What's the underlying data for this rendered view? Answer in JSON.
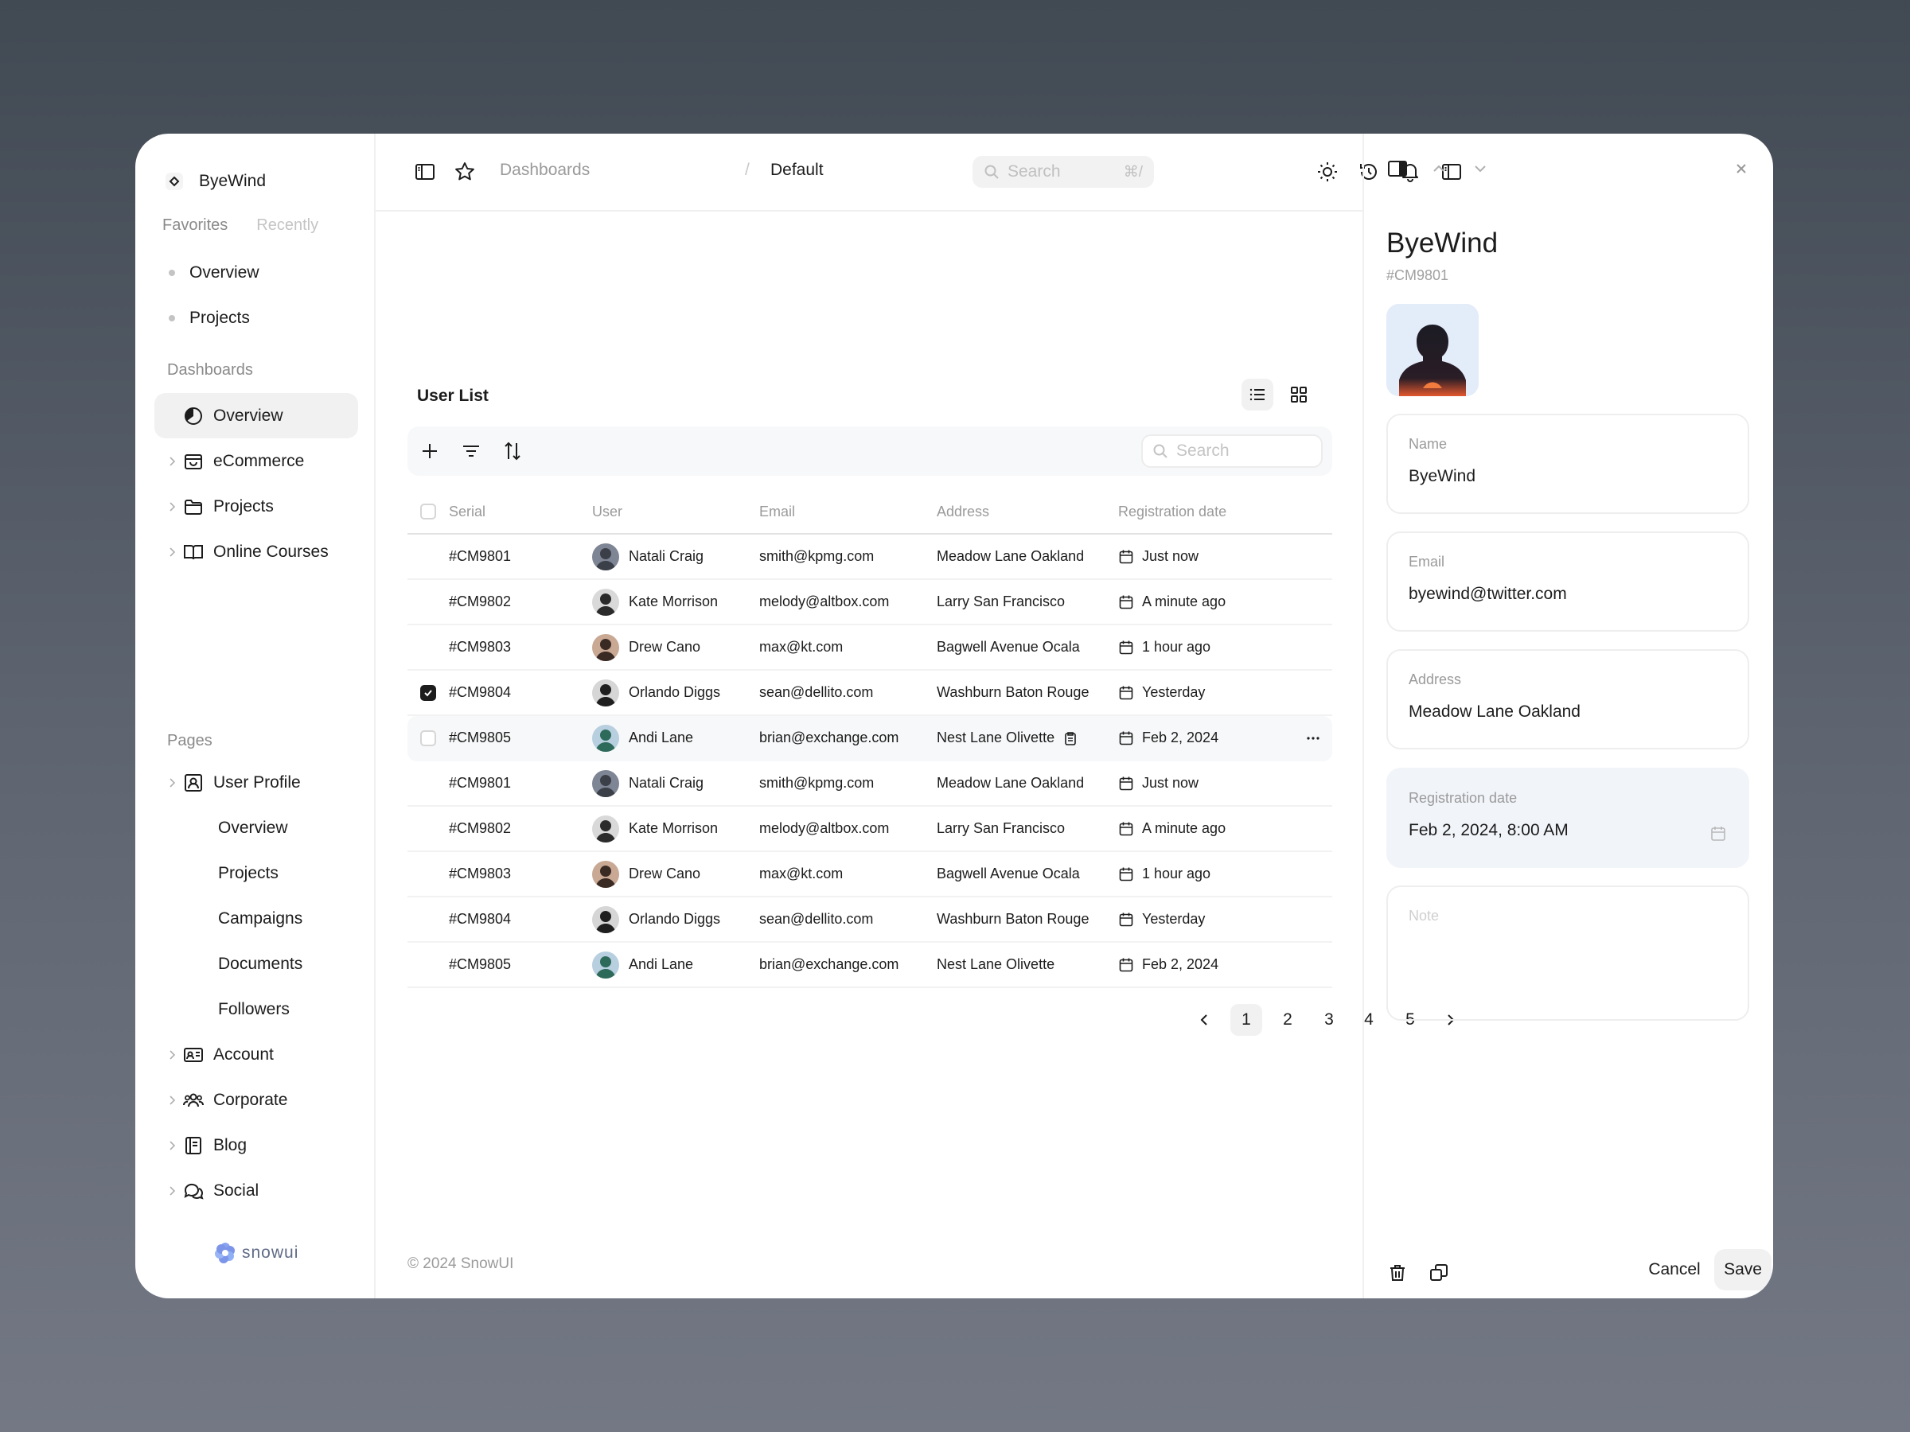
{
  "brand": {
    "name": "ByeWind"
  },
  "favorites": {
    "tabs": [
      "Favorites",
      "Recently"
    ],
    "items": [
      "Overview",
      "Projects"
    ]
  },
  "dashboards": {
    "label": "Dashboards",
    "items": [
      {
        "label": "Overview",
        "icon": "pie-chart-icon",
        "active": true
      },
      {
        "label": "eCommerce",
        "icon": "shopping-bag-icon"
      },
      {
        "label": "Projects",
        "icon": "folder-icon"
      },
      {
        "label": "Online Courses",
        "icon": "book-open-icon"
      }
    ]
  },
  "pages": {
    "label": "Pages",
    "user_profile": "User Profile",
    "user_profile_sub": [
      "Overview",
      "Projects",
      "Campaigns",
      "Documents",
      "Followers"
    ],
    "items": [
      {
        "label": "Account",
        "icon": "id-card-icon"
      },
      {
        "label": "Corporate",
        "icon": "users-icon"
      },
      {
        "label": "Blog",
        "icon": "notebook-icon"
      },
      {
        "label": "Social",
        "icon": "chat-bubbles-icon"
      }
    ]
  },
  "footer_logo": "snowui",
  "topbar": {
    "breadcrumb": [
      "Dashboards",
      "/",
      "Default"
    ],
    "search_placeholder": "Search",
    "search_shortcut": "⌘/"
  },
  "user_list": {
    "title": "User List",
    "search_placeholder": "Search",
    "columns": [
      "Serial",
      "User",
      "Email",
      "Address",
      "Registration date"
    ],
    "rows": [
      {
        "serial": "#CM9801",
        "user": "Natali Craig",
        "email": "smith@kpmg.com",
        "address": "Meadow Lane Oakland",
        "date": "Just now",
        "checked": false
      },
      {
        "serial": "#CM9802",
        "user": "Kate Morrison",
        "email": "melody@altbox.com",
        "address": "Larry San Francisco",
        "date": "A minute ago",
        "checked": false
      },
      {
        "serial": "#CM9803",
        "user": "Drew Cano",
        "email": "max@kt.com",
        "address": "Bagwell Avenue Ocala",
        "date": "1 hour ago",
        "checked": false
      },
      {
        "serial": "#CM9804",
        "user": "Orlando Diggs",
        "email": "sean@dellito.com",
        "address": "Washburn Baton Rouge",
        "date": "Yesterday",
        "checked": true
      },
      {
        "serial": "#CM9805",
        "user": "Andi Lane",
        "email": "brian@exchange.com",
        "address": "Nest Lane Olivette",
        "date": "Feb 2, 2024",
        "checked": false,
        "hover": true
      },
      {
        "serial": "#CM9801",
        "user": "Natali Craig",
        "email": "smith@kpmg.com",
        "address": "Meadow Lane Oakland",
        "date": "Just now",
        "checked": false
      },
      {
        "serial": "#CM9802",
        "user": "Kate Morrison",
        "email": "melody@altbox.com",
        "address": "Larry San Francisco",
        "date": "A minute ago",
        "checked": false
      },
      {
        "serial": "#CM9803",
        "user": "Drew Cano",
        "email": "max@kt.com",
        "address": "Bagwell Avenue Ocala",
        "date": "1 hour ago",
        "checked": false
      },
      {
        "serial": "#CM9804",
        "user": "Orlando Diggs",
        "email": "sean@dellito.com",
        "address": "Washburn Baton Rouge",
        "date": "Yesterday",
        "checked": false
      },
      {
        "serial": "#CM9805",
        "user": "Andi Lane",
        "email": "brian@exchange.com",
        "address": "Nest Lane Olivette",
        "date": "Feb 2, 2024",
        "checked": false
      }
    ],
    "pages": [
      "1",
      "2",
      "3",
      "4",
      "5"
    ],
    "current_page": "1"
  },
  "copyright": "© 2024 SnowUI",
  "panel": {
    "title": "ByeWind",
    "id": "#CM9801",
    "fields": {
      "name_label": "Name",
      "name_value": "ByeWind",
      "email_label": "Email",
      "email_value": "byewind@twitter.com",
      "address_label": "Address",
      "address_value": "Meadow Lane Oakland",
      "date_label": "Registration date",
      "date_value": "Feb 2, 2024, 8:00 AM",
      "note_placeholder": "Note"
    },
    "cancel_label": "Cancel",
    "save_label": "Save"
  },
  "colors": {
    "background_top": "#414953",
    "background_bottom": "#737884",
    "active_nav": "#f1f1f2",
    "filled_field": "#f1f4f9",
    "snow_blue": "#7c95e8"
  }
}
